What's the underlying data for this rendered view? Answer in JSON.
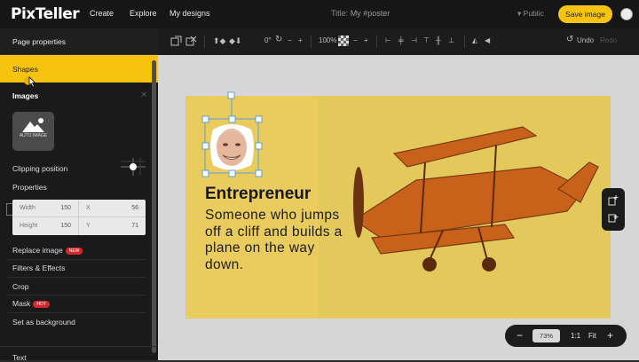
{
  "brand": {
    "logo": "PixTeller",
    "accent": "#f6c40e"
  },
  "header": {
    "nav": [
      "Create",
      "Explore",
      "My designs"
    ],
    "title_label": "Title:",
    "title_value": "My #poster",
    "visibility": "Public",
    "save_label": "Save image"
  },
  "sidebar": {
    "page_properties": "Page properties",
    "shapes": "Shapes",
    "images_title": "Images",
    "auto_image_label": "AUTO IMAGE",
    "clipping_position": "Clipping position",
    "properties": "Properties",
    "fields": {
      "width_label": "Width",
      "width_value": "150",
      "x_label": "X",
      "x_value": "56",
      "height_label": "Height",
      "height_value": "150",
      "y_label": "Y",
      "y_value": "71"
    },
    "menu": {
      "replace_image": "Replace image",
      "replace_badge": "NEW",
      "filters_effects": "Filters & Effects",
      "crop": "Crop",
      "mask": "Mask",
      "mask_badge": "HOT",
      "set_background": "Set as background",
      "text": "Text"
    }
  },
  "toolbar": {
    "rotation": "0°",
    "opacity": "100%",
    "undo": "Undo",
    "redo": "Redo"
  },
  "poster": {
    "headline": "Entrepreneur",
    "body": "Someone who jumps off a cliff and builds a plane on the way down."
  },
  "zoom": {
    "value": "73%",
    "one_to_one": "1:1",
    "fit": "Fit"
  }
}
